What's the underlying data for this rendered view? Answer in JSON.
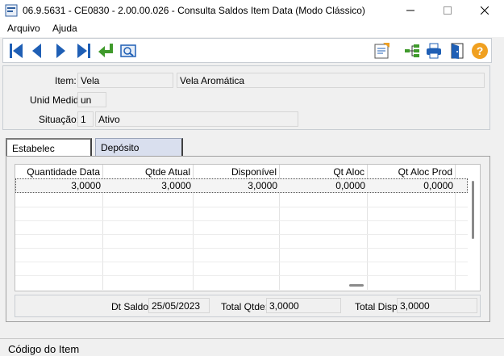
{
  "window": {
    "title": "06.9.5631 - CE0830 - 2.00.00.026 - Consulta Saldos Item Data (Modo Clássico)"
  },
  "menu": {
    "items": [
      "Arquivo",
      "Ajuda"
    ]
  },
  "toolbar": {
    "left_icons": [
      "first-record-icon",
      "previous-record-icon",
      "next-record-icon",
      "last-record-icon",
      "goto-icon",
      "search-icon"
    ],
    "right_icons": [
      "report-icon",
      "hierarchy-icon",
      "printer-icon",
      "exit-door-icon",
      "help-icon"
    ]
  },
  "form": {
    "item": {
      "label": "Item:",
      "code": "Vela",
      "description": "Vela Aromática"
    },
    "unit": {
      "label": "Unid Medid:",
      "value": "un"
    },
    "situation": {
      "label": "Situação:",
      "code": "1",
      "description": "Ativo"
    }
  },
  "tabs": [
    {
      "label": "Estabelec",
      "active": true
    },
    {
      "label": "Depósito",
      "active": false
    }
  ],
  "grid": {
    "columns": [
      "Quantidade Data",
      "Qtde Atual",
      "Disponível",
      "Qt Aloc",
      "Qt Aloc Prod"
    ],
    "rows": [
      [
        "3,0000",
        "3,0000",
        "3,0000",
        "0,0000",
        "0,0000"
      ]
    ]
  },
  "totals": {
    "dt_saldo_label": "Dt Saldo:",
    "dt_saldo_value": "25/05/2023",
    "total_qtde_label": "Total Qtde:",
    "total_qtde_value": "3,0000",
    "total_disp_label": "Total Disp:",
    "total_disp_value": "3,0000"
  },
  "status_bar": {
    "text": "Código do Item"
  },
  "colors": {
    "nav_blue": "#1f5fb5",
    "goto_green": "#3f9a2b",
    "help_orange": "#f0a020",
    "tab_inactive": "#d9dfee"
  }
}
